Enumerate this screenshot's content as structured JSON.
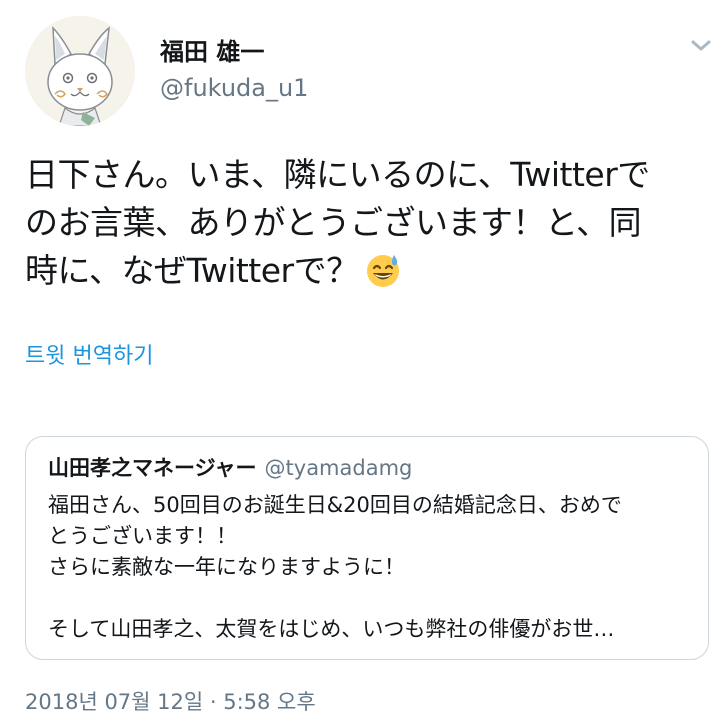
{
  "author": {
    "display_name": "福田 雄一",
    "handle": "@fukuda_u1",
    "avatar_icon": "cat-drawing-avatar"
  },
  "menu": {
    "icon": "chevron-down-icon"
  },
  "tweet": {
    "lines": [
      "日下さん。いま、隣にいるのに、Twitterで",
      "のお言葉、ありがとうございます！と、同",
      "時に、なぜTwitterで？"
    ],
    "emoji": "grinning-face-with-sweat-emoji"
  },
  "translate_label": "트윗 번역하기",
  "quote": {
    "name": "山田孝之マネージャー",
    "handle": "@tyamadamg",
    "lines": [
      "福田さん、50回目のお誕生日&20回目の結婚記念日、おめで",
      "とうございます！！",
      "さらに素敵な一年になりますように！",
      "",
      "そして山田孝之、太賀をはじめ、いつも弊社の俳優がお世…"
    ]
  },
  "timestamp": "2018년 07월 12일 · 5:58 오후",
  "colors": {
    "link": "#1b95e0",
    "secondary_text": "#657786",
    "primary_text": "#14171a",
    "border": "#ccd6dd"
  }
}
